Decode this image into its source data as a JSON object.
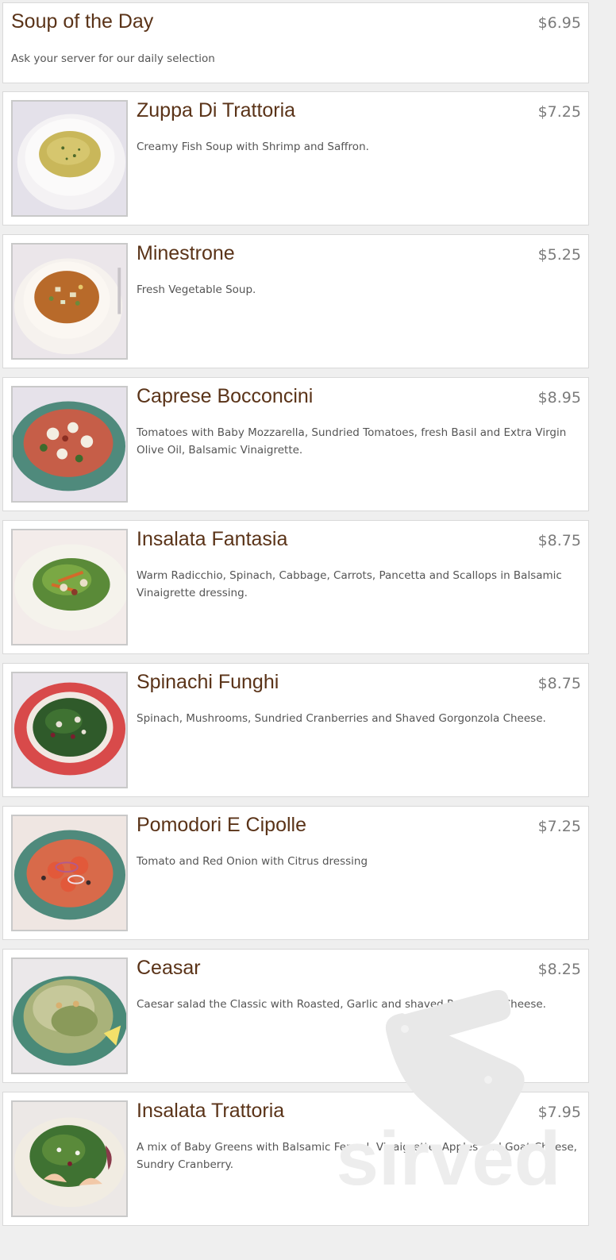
{
  "menu": {
    "items": [
      {
        "title": "Soup of the Day",
        "price": "$6.95",
        "description": "Ask your server for our daily selection",
        "photo": null
      },
      {
        "title": "Zuppa Di Trattoria",
        "price": "$7.25",
        "description": "Creamy Fish Soup with Shrimp and Saffron.",
        "photo": "cream-soup-bowl"
      },
      {
        "title": "Minestrone",
        "price": "$5.25",
        "description": "Fresh Vegetable Soup.",
        "photo": "vegetable-soup-bowl"
      },
      {
        "title": "Caprese Bocconcini",
        "price": "$8.95",
        "description": "Tomatoes with Baby Mozzarella, Sundried Tomatoes, fresh Basil and Extra Virgin Olive Oil, Balsamic Vinaigrette.",
        "photo": "caprese-plate"
      },
      {
        "title": "Insalata Fantasia",
        "price": "$8.75",
        "description": "Warm Radicchio, Spinach, Cabbage, Carrots, Pancetta and Scallops in Balsamic Vinaigrette dressing.",
        "photo": "warm-salad-plate"
      },
      {
        "title": "Spinachi Funghi",
        "price": "$8.75",
        "description": "Spinach, Mushrooms, Sundried Cranberries and Shaved Gorgonzola Cheese.",
        "photo": "spinach-salad-red-plate"
      },
      {
        "title": "Pomodori E Cipolle",
        "price": "$7.25",
        "description": "Tomato and Red Onion with Citrus dressing",
        "photo": "tomato-onion-plate"
      },
      {
        "title": "Ceasar",
        "price": "$8.25",
        "description": "Caesar salad the Classic with Roasted, Garlic and shaved Parmesan Cheese.",
        "photo": "caesar-salad-plate"
      },
      {
        "title": "Insalata Trattoria",
        "price": "$7.95",
        "description": "A mix of Baby Greens with Balsamic Fennel, Vinaigrette, Apples and Goat Cheese, Sundry Cranberry.",
        "photo": "mixed-greens-plate"
      }
    ]
  },
  "watermark": {
    "text": "sirved",
    "icon": "knife-fork-icon"
  },
  "colors": {
    "title": "#5a3318",
    "price": "#7b7b7b",
    "description": "#555555",
    "page_background": "#efefef"
  }
}
